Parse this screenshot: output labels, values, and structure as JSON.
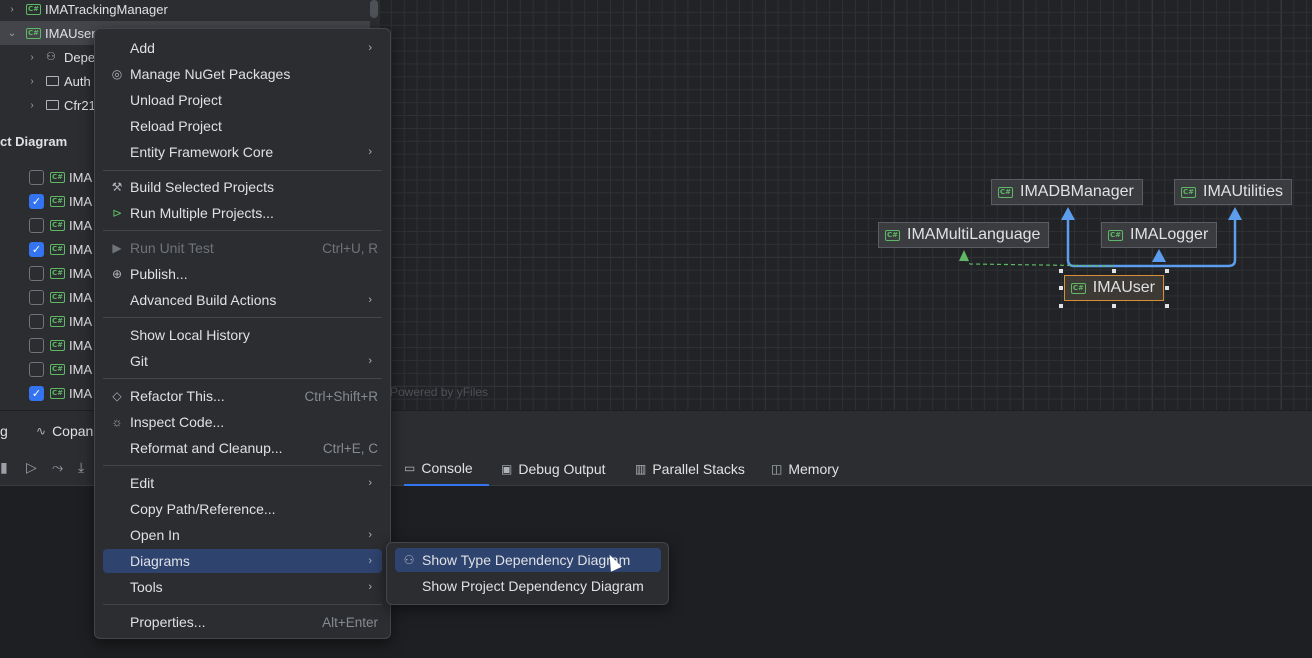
{
  "tree": {
    "rows": [
      {
        "label": "IMATrackingManager"
      },
      {
        "label": "IMAUser"
      },
      {
        "label": "Depe"
      },
      {
        "label": "Auth"
      },
      {
        "label": "Cfr21"
      }
    ],
    "section_title": "ct Diagram",
    "checklist": [
      {
        "label": "IMA",
        "checked": false
      },
      {
        "label": "IMA",
        "checked": true
      },
      {
        "label": "IMA",
        "checked": false
      },
      {
        "label": "IMA",
        "checked": true
      },
      {
        "label": "IMA",
        "checked": false
      },
      {
        "label": "IMA",
        "checked": false
      },
      {
        "label": "IMA",
        "checked": false
      },
      {
        "label": "IMA",
        "checked": false
      },
      {
        "label": "IMA",
        "checked": false
      },
      {
        "label": "IMA",
        "checked": true
      }
    ],
    "badge": "C#"
  },
  "diagram": {
    "nodes": {
      "dbmanager": "IMADBManager",
      "utilities": "IMAUtilities",
      "multilanguage": "IMAMultiLanguage",
      "logger": "IMALogger",
      "user": "IMAUser"
    },
    "powered_by": "Powered by yFiles",
    "colors": {
      "solid_edge": "#5c9ded",
      "dashed_edge": "#5fb865",
      "selected_border": "#d88f3a"
    }
  },
  "bottom": {
    "left_tab_fragment": "g",
    "copilot_tab": "Copan",
    "tabs": [
      "Console",
      "Debug Output",
      "Parallel Stacks",
      "Memory"
    ]
  },
  "context_menu": {
    "items": {
      "add": "Add",
      "manage_nuget": "Manage NuGet Packages",
      "unload": "Unload Project",
      "reload": "Reload Project",
      "ef_core": "Entity Framework Core",
      "build_selected": "Build Selected Projects",
      "run_multiple": "Run Multiple Projects...",
      "run_unit_test": "Run Unit Test",
      "run_unit_test_shortcut": "Ctrl+U, R",
      "publish": "Publish...",
      "advanced_build": "Advanced Build Actions",
      "local_history": "Show Local History",
      "git": "Git",
      "refactor": "Refactor This...",
      "refactor_shortcut": "Ctrl+Shift+R",
      "inspect": "Inspect Code...",
      "reformat": "Reformat and Cleanup...",
      "reformat_shortcut": "Ctrl+E, C",
      "edit": "Edit",
      "copy_path": "Copy Path/Reference...",
      "open_in": "Open In",
      "diagrams": "Diagrams",
      "tools": "Tools",
      "properties": "Properties...",
      "properties_shortcut": "Alt+Enter"
    }
  },
  "submenu": {
    "type_dependency": "Show Type Dependency Diagram",
    "project_dependency": "Show Project Dependency Diagram"
  }
}
